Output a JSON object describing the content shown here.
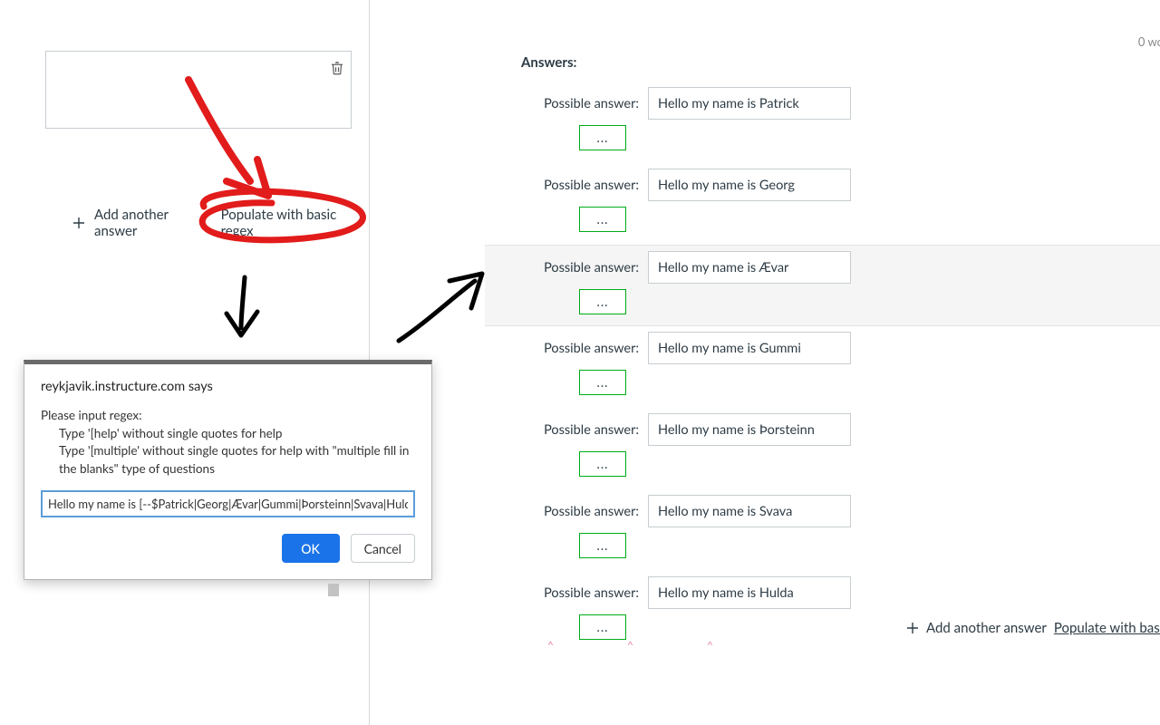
{
  "left": {
    "add_answer_label": "Add another answer",
    "populate_label": "Populate with basic regex"
  },
  "right": {
    "heading": "Answers:",
    "pa_label": "Possible answer:",
    "dots_label": "...",
    "answers": [
      "Hello my name is Patrick",
      "Hello my name is Georg",
      "Hello my name is Ævar",
      "Hello my name is Gummi",
      "Hello my name is Þorsteinn",
      "Hello my name is Svava",
      "Hello my name is Hulda"
    ],
    "add_answer_label": "Add another answer",
    "populate_label": "Populate with basic regex"
  },
  "dialog": {
    "title": "reykjavik.instructure.com says",
    "line1": "Please input regex:",
    "line2": "Type '[help' without single quotes for help",
    "line3": "Type '[multiple' without single quotes for help with \"multiple fill in the blanks\" type of questions",
    "input_value": "Hello my name is [--$Patrick|Georg|Ævar|Gummi|Þorsteinn|Svava|Hulda]",
    "ok_label": "OK",
    "cancel_label": "Cancel"
  },
  "stray_top_right": "0 wo"
}
